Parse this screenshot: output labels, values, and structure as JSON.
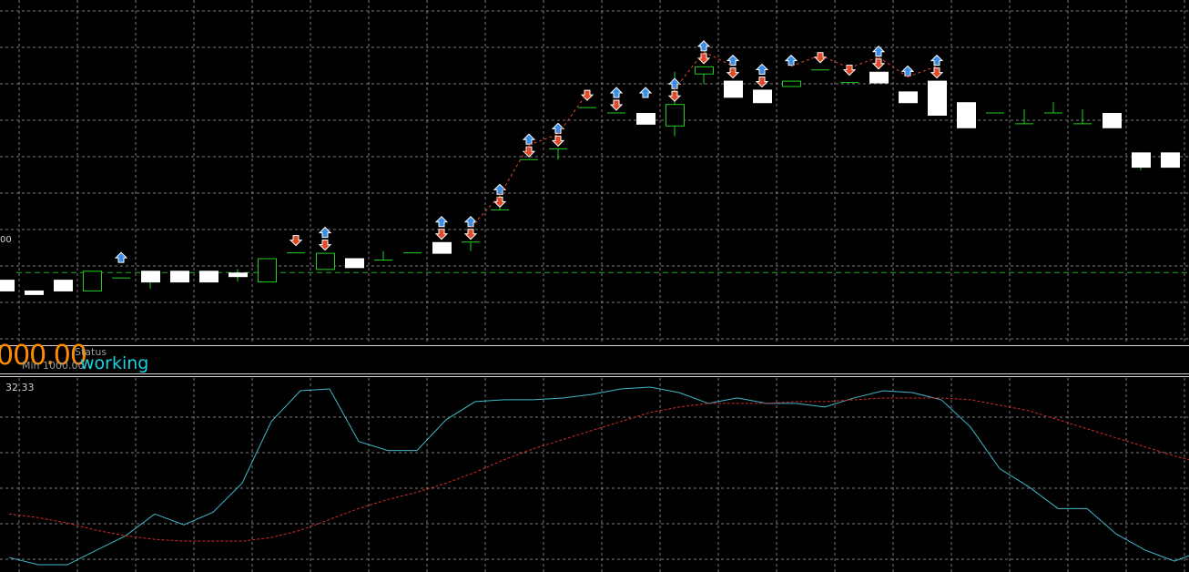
{
  "panel": {
    "level_label": "00",
    "big_value": "000.00",
    "status_label": "Status",
    "min_label": "Min 1000.00",
    "status_value": "working",
    "indicator_value": "32.33"
  },
  "colors": {
    "background": "#000000",
    "grid": "#9a9a9a",
    "bull_candle_body": "#000000",
    "bull_candle_border": "#22cc22",
    "bear_candle_body": "#ffffff",
    "wick": "#22cc22",
    "level_line": "#22aa22",
    "buy_arrow": "#3a8ee6",
    "sell_arrow": "#e04a2a",
    "fast_line": "#3fb8c8",
    "slow_line": "#d22a2a",
    "separator": "#d8d8d8"
  },
  "chart_data": [
    {
      "type": "candlestick",
      "grid": true,
      "reference_level": 2.0,
      "ylim": [
        0,
        9.6
      ],
      "candles": [
        {
          "o": 1.8,
          "h": 1.8,
          "l": 1.5,
          "c": 1.5,
          "buy": false,
          "sell": false
        },
        {
          "o": 1.5,
          "h": 1.5,
          "l": 1.4,
          "c": 1.4,
          "buy": false,
          "sell": false
        },
        {
          "o": 1.8,
          "h": 1.8,
          "l": 1.5,
          "c": 1.5,
          "buy": false,
          "sell": false
        },
        {
          "o": 1.5,
          "h": 2.05,
          "l": 1.5,
          "c": 2.05,
          "buy": false,
          "sell": false
        },
        {
          "o": 1.85,
          "h": 1.85,
          "l": 1.85,
          "c": 1.85,
          "buy": true,
          "sell": false
        },
        {
          "o": 2.05,
          "h": 2.05,
          "l": 1.55,
          "c": 1.75,
          "buy": false,
          "sell": false
        },
        {
          "o": 2.05,
          "h": 2.05,
          "l": 1.75,
          "c": 1.75,
          "buy": false,
          "sell": false
        },
        {
          "o": 2.05,
          "h": 2.05,
          "l": 1.75,
          "c": 1.75,
          "buy": false,
          "sell": false
        },
        {
          "o": 2.0,
          "h": 2.1,
          "l": 1.75,
          "c": 1.9,
          "buy": false,
          "sell": false
        },
        {
          "o": 1.75,
          "h": 2.4,
          "l": 1.75,
          "c": 2.4,
          "buy": false,
          "sell": false
        },
        {
          "o": 2.55,
          "h": 2.55,
          "l": 2.55,
          "c": 2.55,
          "buy": false,
          "sell": true
        },
        {
          "o": 2.1,
          "h": 2.55,
          "l": 2.1,
          "c": 2.55,
          "buy": true,
          "sell": true
        },
        {
          "o": 2.4,
          "h": 2.4,
          "l": 2.15,
          "c": 2.15,
          "buy": false,
          "sell": false
        },
        {
          "o": 2.35,
          "h": 2.6,
          "l": 2.35,
          "c": 2.35,
          "buy": false,
          "sell": false
        },
        {
          "o": 2.55,
          "h": 2.55,
          "l": 2.55,
          "c": 2.55,
          "buy": false,
          "sell": false
        },
        {
          "o": 2.85,
          "h": 2.85,
          "l": 2.55,
          "c": 2.55,
          "buy": true,
          "sell": true
        },
        {
          "o": 2.85,
          "h": 2.85,
          "l": 2.6,
          "c": 2.85,
          "buy": true,
          "sell": true
        },
        {
          "o": 3.75,
          "h": 4.15,
          "l": 3.75,
          "c": 3.75,
          "buy": true,
          "sell": true
        },
        {
          "o": 5.15,
          "h": 5.15,
          "l": 5.15,
          "c": 5.15,
          "buy": true,
          "sell": true
        },
        {
          "o": 5.45,
          "h": 5.45,
          "l": 5.15,
          "c": 5.45,
          "buy": true,
          "sell": true
        },
        {
          "o": 6.6,
          "h": 6.6,
          "l": 6.6,
          "c": 6.6,
          "buy": false,
          "sell": true
        },
        {
          "o": 6.45,
          "h": 6.45,
          "l": 6.45,
          "c": 6.45,
          "buy": true,
          "sell": true
        },
        {
          "o": 6.45,
          "h": 6.45,
          "l": 6.15,
          "c": 6.15,
          "buy": true,
          "sell": false
        },
        {
          "o": 6.1,
          "h": 7.6,
          "l": 5.8,
          "c": 6.7,
          "buy": true,
          "sell": true
        },
        {
          "o": 7.55,
          "h": 7.75,
          "l": 7.25,
          "c": 7.75,
          "buy": true,
          "sell": true
        },
        {
          "o": 7.35,
          "h": 7.35,
          "l": 6.9,
          "c": 6.9,
          "buy": true,
          "sell": true
        },
        {
          "o": 7.1,
          "h": 7.1,
          "l": 6.75,
          "c": 6.75,
          "buy": true,
          "sell": true
        },
        {
          "o": 7.2,
          "h": 7.35,
          "l": 7.2,
          "c": 7.35,
          "buy": true,
          "sell": false
        },
        {
          "o": 7.65,
          "h": 7.65,
          "l": 7.65,
          "c": 7.65,
          "buy": false,
          "sell": true
        },
        {
          "o": 7.3,
          "h": 7.3,
          "l": 7.3,
          "c": 7.3,
          "buy": false,
          "sell": true
        },
        {
          "o": 7.6,
          "h": 7.6,
          "l": 7.3,
          "c": 7.3,
          "buy": true,
          "sell": true
        },
        {
          "o": 7.05,
          "h": 7.05,
          "l": 6.75,
          "c": 6.75,
          "buy": true,
          "sell": false
        },
        {
          "o": 7.35,
          "h": 7.35,
          "l": 6.4,
          "c": 6.4,
          "buy": true,
          "sell": true
        },
        {
          "o": 6.75,
          "h": 6.75,
          "l": 6.05,
          "c": 6.05,
          "buy": false,
          "sell": false
        },
        {
          "o": 6.45,
          "h": 6.45,
          "l": 6.45,
          "c": 6.45,
          "buy": false,
          "sell": false
        },
        {
          "o": 6.15,
          "h": 6.55,
          "l": 6.15,
          "c": 6.15,
          "buy": false,
          "sell": false
        },
        {
          "o": 6.45,
          "h": 6.75,
          "l": 6.45,
          "c": 6.45,
          "buy": false,
          "sell": false
        },
        {
          "o": 6.15,
          "h": 6.55,
          "l": 6.15,
          "c": 6.15,
          "buy": false,
          "sell": false
        },
        {
          "o": 6.45,
          "h": 6.45,
          "l": 6.05,
          "c": 6.05,
          "buy": false,
          "sell": false
        },
        {
          "o": 5.35,
          "h": 5.35,
          "l": 4.85,
          "c": 4.95,
          "buy": false,
          "sell": false
        },
        {
          "o": 5.35,
          "h": 5.35,
          "l": 4.95,
          "c": 4.95,
          "buy": false,
          "sell": false
        }
      ]
    },
    {
      "type": "line",
      "grid": true,
      "ylim": [
        0,
        100
      ],
      "series": [
        {
          "values": [
            6,
            2,
            2,
            10,
            18,
            30,
            24,
            31,
            47,
            81,
            98,
            99,
            70,
            65,
            65,
            82,
            92,
            93,
            93,
            94,
            96,
            99,
            100,
            97,
            91,
            94,
            91,
            91,
            89,
            94,
            98,
            97,
            93,
            78,
            55,
            45,
            33,
            33,
            19,
            10,
            4,
            10
          ]
        },
        {
          "values": [
            30,
            28,
            25,
            21,
            18,
            16,
            15,
            15,
            15,
            17,
            21,
            27,
            33,
            38,
            42,
            47,
            53,
            60,
            66,
            71,
            76,
            81,
            86,
            89,
            91,
            91,
            91,
            92,
            92,
            93,
            94,
            94,
            94,
            93,
            90,
            87,
            82,
            77,
            72,
            67,
            62,
            58
          ]
        }
      ]
    }
  ]
}
